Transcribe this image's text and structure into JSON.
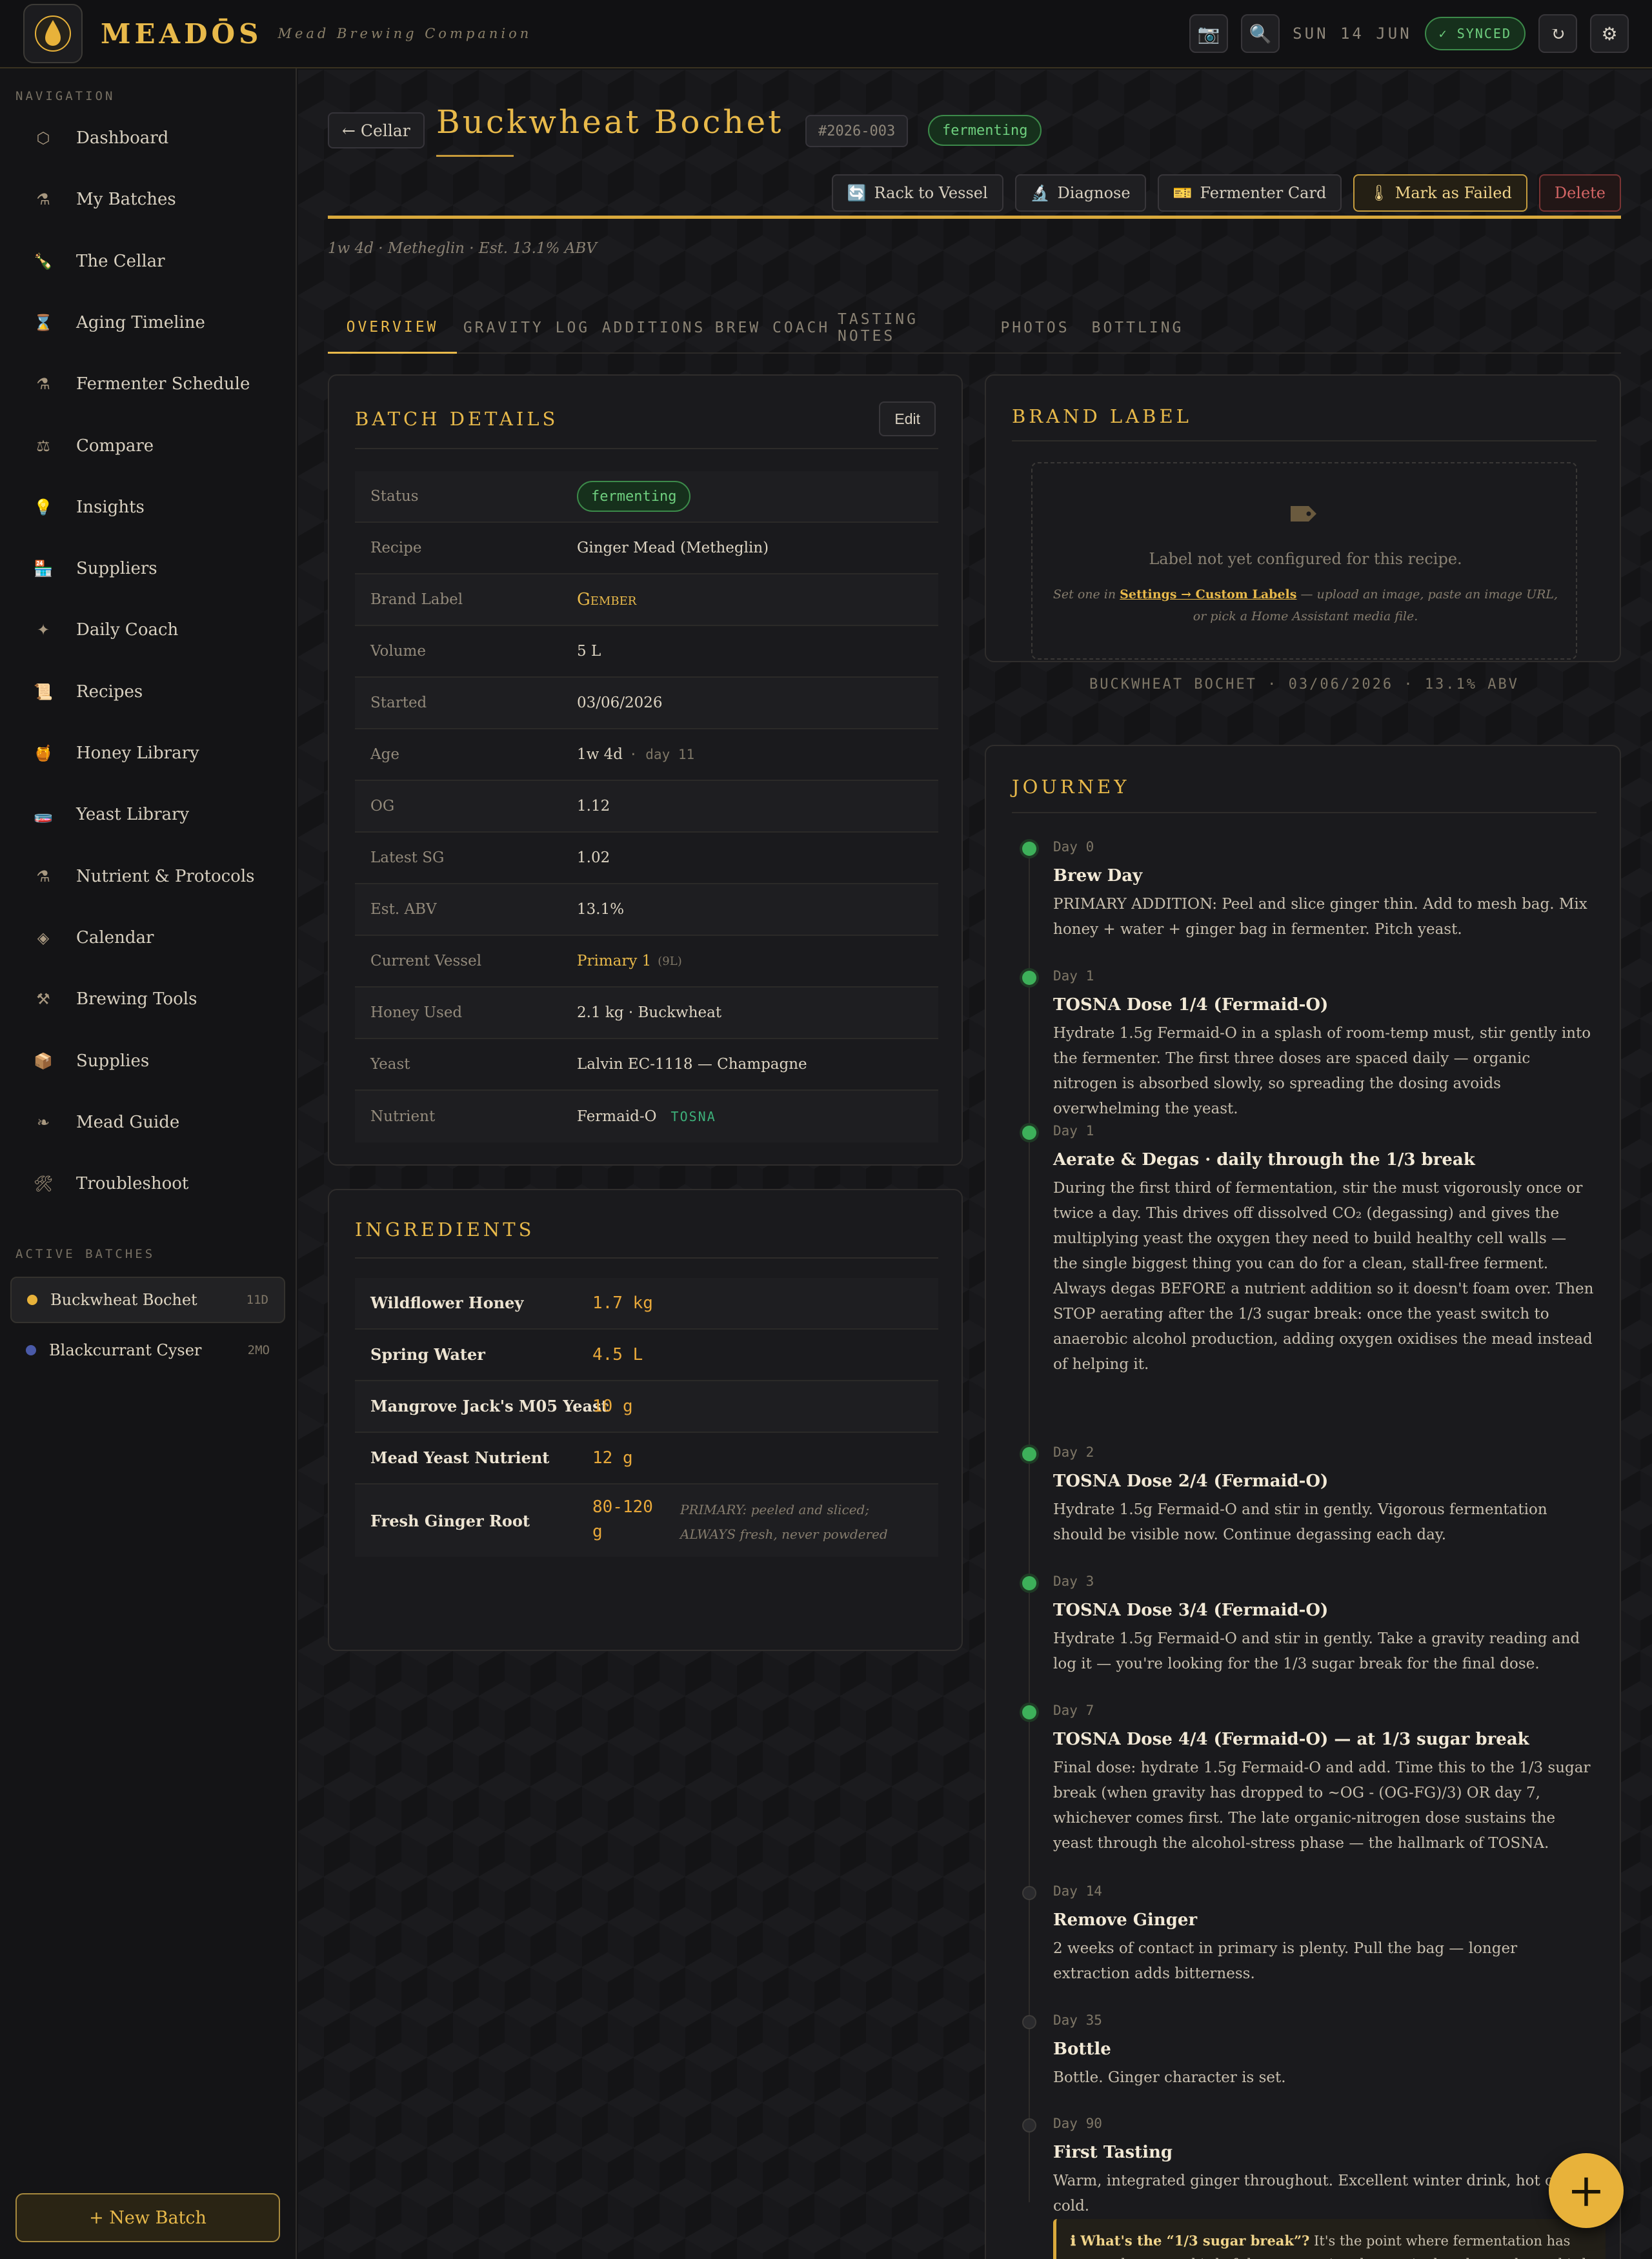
{
  "app": {
    "name": "MEADŌS",
    "tagline": "Mead Brewing Companion",
    "date": "SUN 14 JUN",
    "sync_status": "✓ SYNCED"
  },
  "sidebar": {
    "nav_heading": "NAVIGATION",
    "items": [
      {
        "label": "Dashboard",
        "icon": "⬡"
      },
      {
        "label": "My Batches",
        "icon": "⚗"
      },
      {
        "label": "The Cellar",
        "icon": "🍾"
      },
      {
        "label": "Aging Timeline",
        "icon": "⌛"
      },
      {
        "label": "Fermenter Schedule",
        "icon": "⚗"
      },
      {
        "label": "Compare",
        "icon": "⚖"
      },
      {
        "label": "Insights",
        "icon": "💡"
      },
      {
        "label": "Suppliers",
        "icon": "🏪"
      },
      {
        "label": "Daily Coach",
        "icon": "✦"
      },
      {
        "label": "Recipes",
        "icon": "📜"
      },
      {
        "label": "Honey Library",
        "icon": "🍯"
      },
      {
        "label": "Yeast Library",
        "icon": "🧫"
      },
      {
        "label": "Nutrient & Protocols",
        "icon": "⚗"
      },
      {
        "label": "Calendar",
        "icon": "◈"
      },
      {
        "label": "Brewing Tools",
        "icon": "⚒"
      },
      {
        "label": "Supplies",
        "icon": "📦"
      },
      {
        "label": "Mead Guide",
        "icon": "❧"
      },
      {
        "label": "Troubleshoot",
        "icon": "🛠"
      }
    ],
    "batches_heading": "ACTIVE BATCHES",
    "batches": [
      {
        "name": "Buckwheat Bochet",
        "age": "11D",
        "color": "#e8b23a"
      },
      {
        "name": "Blackcurrant Cyser",
        "age": "2MO",
        "color": "#4a5aa8"
      }
    ],
    "new_batch": "+ New Batch"
  },
  "header": {
    "back": "← Cellar",
    "title": "Buckwheat Bochet",
    "code": "#2026-003",
    "status": "fermenting",
    "subline": "1w 4d · Metheglin · Est. 13.1% ABV",
    "actions": [
      {
        "label": "Rack to Vessel",
        "icon": "🔄"
      },
      {
        "label": "Diagnose",
        "icon": "🔬"
      },
      {
        "label": "Fermenter Card",
        "icon": "🎫"
      },
      {
        "label": "Mark as Failed",
        "icon": "🌡"
      },
      {
        "label": "Delete",
        "icon": ""
      }
    ]
  },
  "tabs": [
    "OVERVIEW",
    "GRAVITY LOG",
    "ADDITIONS",
    "BREW COACH",
    "TASTING NOTES",
    "PHOTOS",
    "BOTTLING"
  ],
  "details": {
    "title": "BATCH DETAILS",
    "edit": "Edit",
    "rows": [
      {
        "label": "Status",
        "value": "fermenting"
      },
      {
        "label": "Recipe",
        "value": "Ginger Mead (Metheglin)"
      },
      {
        "label": "Brand Label",
        "value": "Gember"
      },
      {
        "label": "Volume",
        "value": "5 L"
      },
      {
        "label": "Started",
        "value": "03/06/2026"
      },
      {
        "label": "Age",
        "value": "1w 4d",
        "extra": "· day 11"
      },
      {
        "label": "OG",
        "value": "1.12"
      },
      {
        "label": "Latest SG",
        "value": "1.02"
      },
      {
        "label": "Est. ABV",
        "value": "13.1%"
      },
      {
        "label": "Current Vessel",
        "value": "Primary 1",
        "extra": "(9L)"
      },
      {
        "label": "Honey Used",
        "value": "2.1 kg · Buckwheat"
      },
      {
        "label": "Yeast",
        "value": "Lalvin EC-1118 — Champagne"
      },
      {
        "label": "Nutrient",
        "value": "Fermaid-O",
        "extra": "TOSNA"
      }
    ]
  },
  "ingredients": {
    "title": "INGREDIENTS",
    "rows": [
      {
        "name": "Wildflower Honey",
        "qty": "1.7 kg",
        "note": ""
      },
      {
        "name": "Spring Water",
        "qty": "4.5 L",
        "note": ""
      },
      {
        "name": "Mangrove Jack's M05 Yeast",
        "qty": "10 g",
        "note": ""
      },
      {
        "name": "Mead Yeast Nutrient",
        "qty": "12 g",
        "note": ""
      },
      {
        "name": "Fresh Ginger Root",
        "qty": "80-120 g",
        "qty_line1": "80-120",
        "qty_line2": "g",
        "note": "PRIMARY: peeled and sliced; ALWAYS fresh, never powdered"
      }
    ]
  },
  "brand_label": {
    "title": "BRAND LABEL",
    "icon": "tag-icon",
    "empty": "Label not yet configured for this recipe.",
    "hint_pre": "Set one in ",
    "hint_link": "Settings → Custom Labels",
    "hint_post": " — upload an image, paste an image URL, or pick a Home Assistant media file.",
    "footer": "BUCKWHEAT BOCHET · 03/06/2026 · 13.1% ABV"
  },
  "journey": {
    "title": "JOURNEY",
    "steps": [
      {
        "day": "Day 0",
        "title": "Brew Day",
        "text": "PRIMARY ADDITION: Peel and slice ginger thin. Add to mesh bag. Mix honey + water + ginger bag in fermenter. Pitch yeast.",
        "done": true
      },
      {
        "day": "Day 1",
        "title": "TOSNA Dose 1/4 (Fermaid-O)",
        "text": "Hydrate 1.5g Fermaid-O in a splash of room-temp must, stir gently into the fermenter. The first three doses are spaced daily — organic nitrogen is absorbed slowly, so spreading the dosing avoids overwhelming the yeast.",
        "done": true
      },
      {
        "day": "Day 1",
        "title": "Aerate & Degas · daily through the 1/3 break",
        "text": "During the first third of fermentation, stir the must vigorously once or twice a day. This drives off dissolved CO₂ (degassing) and gives the multiplying yeast the oxygen they need to build healthy cell walls — the single biggest thing you can do for a clean, stall-free ferment. Always degas BEFORE a nutrient addition so it doesn't foam over. Then STOP aerating after the 1/3 sugar break: once the yeast switch to anaerobic alcohol production, adding oxygen oxidises the mead instead of helping it.",
        "done": true
      },
      {
        "day": "Day 2",
        "title": "TOSNA Dose 2/4 (Fermaid-O)",
        "text": "Hydrate 1.5g Fermaid-O and stir in gently. Vigorous fermentation should be visible now. Continue degassing each day.",
        "done": true
      },
      {
        "day": "Day 3",
        "title": "TOSNA Dose 3/4 (Fermaid-O)",
        "text": "Hydrate 1.5g Fermaid-O and stir in gently. Take a gravity reading and log it — you're looking for the 1/3 sugar break for the final dose.",
        "done": true
      },
      {
        "day": "Day 7",
        "title": "TOSNA Dose 4/4 (Fermaid-O) — at 1/3 sugar break",
        "text": "Final dose: hydrate 1.5g Fermaid-O and add. Time this to the 1/3 sugar break (when gravity has dropped to ~OG - (OG-FG)/3) OR day 7, whichever comes first. The late organic-nitrogen dose sustains the yeast through the alcohol-stress phase — the hallmark of TOSNA.",
        "done": true
      },
      {
        "day": "Day 14",
        "title": "Remove Ginger",
        "text": "2 weeks of contact in primary is plenty. Pull the bag — longer extraction adds bitterness.",
        "done": false
      },
      {
        "day": "Day 35",
        "title": "Bottle",
        "text": "Bottle. Ginger character is set.",
        "done": false
      },
      {
        "day": "Day 90",
        "title": "First Tasting",
        "text": "Warm, integrated ginger throughout. Excellent winter drink, hot or cold.",
        "done": false
      }
    ],
    "callout_title": "ℹ What's the “1/3 sugar break”?",
    "callout_text": "It's the point where fermentation has eaten about one-third of the sugar — i.e. the gravity has dropped one-third of the way from your OG down toward its expected final gravity (≈ OG − (OG − FG) ÷ 3). For a 1.100 must finishing near 1.000 that's about SG 1.067, usually reached around"
  },
  "fab": "+",
  "colors": {
    "accent": "#e8b94a",
    "success": "#3db05a",
    "danger": "#d36565",
    "background": "#141416"
  }
}
